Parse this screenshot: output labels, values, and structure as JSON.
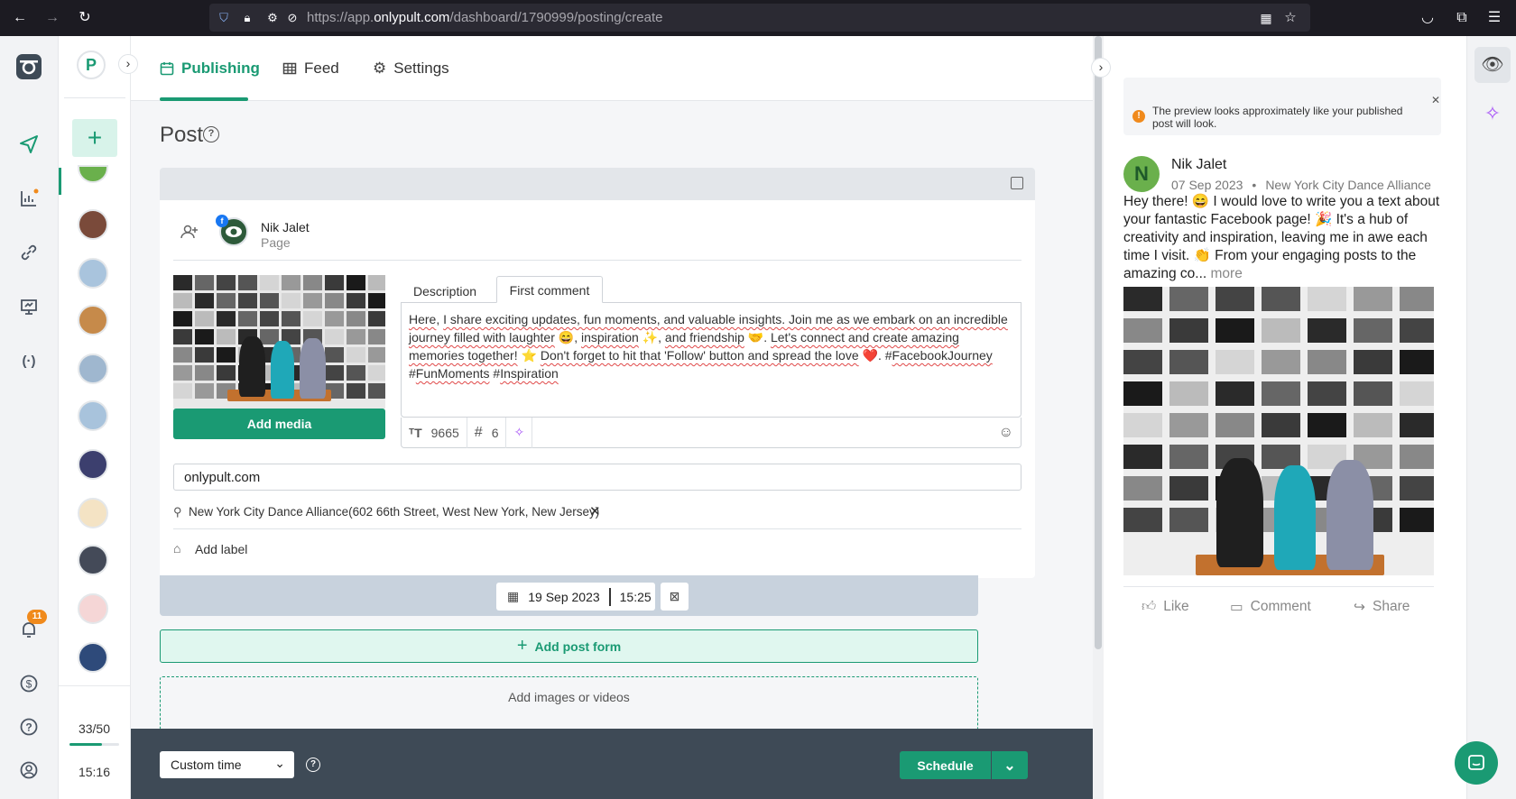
{
  "browser": {
    "url_prefix": "https://app.",
    "url_domain": "onlypult.com",
    "url_path": "/dashboard/1790999/posting/create"
  },
  "rail": {
    "notification_count": "11"
  },
  "accounts": {
    "workspace_letter": "P",
    "add_label": "+",
    "quota": "33/50",
    "quota_fraction": 0.66,
    "time": "15:16"
  },
  "tabs": [
    {
      "label": "Publishing"
    },
    {
      "label": "Feed"
    },
    {
      "label": "Settings"
    }
  ],
  "post": {
    "title": "Post",
    "account_name": "Nik Jalet",
    "account_type": "Page",
    "add_media_label": "Add media",
    "description_tab": "Description",
    "first_comment_tab": "First comment",
    "comment_text": {
      "s1": "Here",
      "s2": ", ",
      "s3": "I share exciting updates, fun moments, and valuable insights. Join me as we embark on an incredible journey filled with laughter",
      "s4": " 😄, ",
      "s5": "inspiration",
      "s6": " ✨, ",
      "s7": "and friendship",
      "s8": " 🤝. ",
      "s9": "Let's connect and create amazing memories together!",
      "s10": " ⭐ ",
      "s11": "Don't forget to hit that 'Follow' button and spread the love",
      "s12": " ❤️. #",
      "s13": "FacebookJourney",
      "s14": " #",
      "s15": "FunMoments",
      "s16": " #",
      "s17": "Inspiration"
    },
    "char_count": "9665",
    "hashtag_count": "6",
    "link_value": "onlypult.com",
    "location": "New York City Dance Alliance(602 66th Street, West New York, New Jersey)",
    "add_label": "Add label",
    "date": "19 Sep 2023",
    "time": "15:25",
    "add_post_form": "Add post form",
    "add_images": "Add images or videos"
  },
  "footer": {
    "time_mode": "Custom time",
    "schedule_label": "Schedule"
  },
  "preview": {
    "notice": "The preview looks approximately like your published post will look.",
    "author_initial": "N",
    "author": "Nik Jalet",
    "date": "07 Sep 2023",
    "separator": "•",
    "location": "New York City Dance Alliance",
    "text": "Hey there! 😄 I would love to write you a text about your fantastic Facebook page! 🎉 It's a hub of creativity and inspiration, leaving me in awe each time I visit. 👏 From your engaging posts to the amazing co...",
    "more": "more",
    "like": "Like",
    "comment": "Comment",
    "share": "Share"
  },
  "colors": {
    "accent": "#1a9a73",
    "footer_bg": "#3e4a56",
    "badge": "#f08a1c"
  }
}
